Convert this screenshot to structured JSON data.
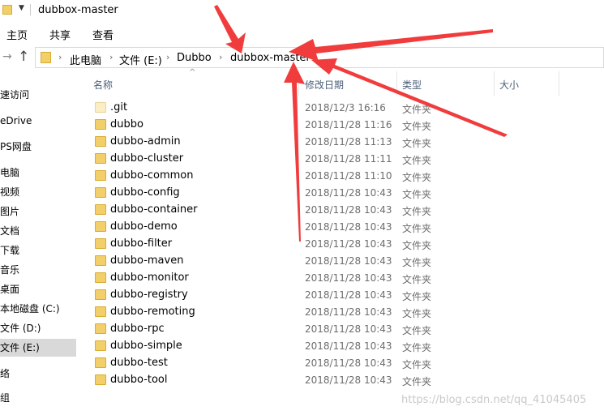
{
  "window": {
    "title": "dubbox-master"
  },
  "ribbon": {
    "tabs": [
      "主页",
      "共享",
      "查看"
    ]
  },
  "address": {
    "segments": [
      "此电脑",
      "文件 (E:)",
      "Dubbo",
      "dubbox-master"
    ]
  },
  "nav_pane": {
    "items": [
      "速访问",
      "eDrive",
      "PS网盘",
      "电脑",
      "视频",
      "图片",
      "文档",
      "下载",
      "音乐",
      "桌面",
      "本地磁盘 (C:)",
      "文件 (D:)",
      "文件 (E:)",
      "络",
      "组"
    ],
    "selected_index": 12
  },
  "columns": {
    "name": "名称",
    "modified": "修改日期",
    "type": "类型",
    "size": "大小"
  },
  "files": [
    {
      "name": ".git",
      "modified": "2018/12/3 16:16",
      "type": "文件夹"
    },
    {
      "name": "dubbo",
      "modified": "2018/11/28 11:16",
      "type": "文件夹"
    },
    {
      "name": "dubbo-admin",
      "modified": "2018/11/28 11:13",
      "type": "文件夹"
    },
    {
      "name": "dubbo-cluster",
      "modified": "2018/11/28 11:11",
      "type": "文件夹"
    },
    {
      "name": "dubbo-common",
      "modified": "2018/11/28 11:10",
      "type": "文件夹"
    },
    {
      "name": "dubbo-config",
      "modified": "2018/11/28 10:43",
      "type": "文件夹"
    },
    {
      "name": "dubbo-container",
      "modified": "2018/11/28 10:43",
      "type": "文件夹"
    },
    {
      "name": "dubbo-demo",
      "modified": "2018/11/28 10:43",
      "type": "文件夹"
    },
    {
      "name": "dubbo-filter",
      "modified": "2018/11/28 10:43",
      "type": "文件夹"
    },
    {
      "name": "dubbo-maven",
      "modified": "2018/11/28 10:43",
      "type": "文件夹"
    },
    {
      "name": "dubbo-monitor",
      "modified": "2018/11/28 10:43",
      "type": "文件夹"
    },
    {
      "name": "dubbo-registry",
      "modified": "2018/11/28 10:43",
      "type": "文件夹"
    },
    {
      "name": "dubbo-remoting",
      "modified": "2018/11/28 10:43",
      "type": "文件夹"
    },
    {
      "name": "dubbo-rpc",
      "modified": "2018/11/28 10:43",
      "type": "文件夹"
    },
    {
      "name": "dubbo-simple",
      "modified": "2018/11/28 10:43",
      "type": "文件夹"
    },
    {
      "name": "dubbo-test",
      "modified": "2018/11/28 10:43",
      "type": "文件夹"
    },
    {
      "name": "dubbo-tool",
      "modified": "2018/11/28 10:43",
      "type": "文件夹"
    }
  ],
  "watermark": "https://blog.csdn.net/qq_41045405",
  "colors": {
    "annotation_arrow": "#f03c3c",
    "folder": "#f3cf6a",
    "selected_nav": "#d9d9d9",
    "header_text": "#4c607a"
  }
}
